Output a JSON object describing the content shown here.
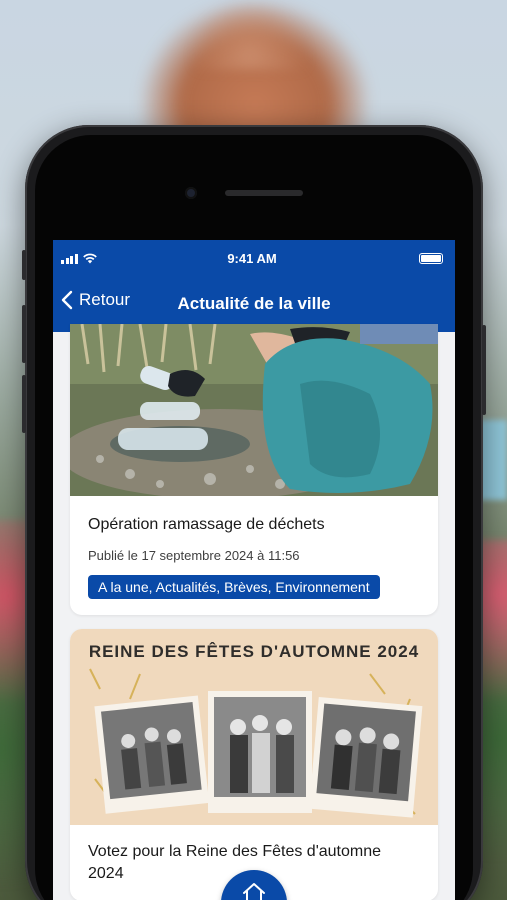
{
  "status_bar": {
    "time": "9:41 AM"
  },
  "nav": {
    "back_label": "Retour",
    "title": "Actualité de la ville"
  },
  "articles": [
    {
      "title": "Opération ramassage de déchets",
      "date": "Publié le 17 septembre 2024 à 11:56",
      "tags": "A la une, Actualités, Brèves, Environnement"
    },
    {
      "image_caption": "REINE DES FÊTES D'AUTOMNE 2024",
      "title": "Votez pour la Reine des Fêtes d'automne 2024"
    }
  ],
  "colors": {
    "brand": "#0a4aa8",
    "tag_bg": "#0a4aa8",
    "screen_bg": "#f1f2f4"
  },
  "icons": [
    "signal-icon",
    "wifi-icon",
    "battery-icon",
    "back-chevron-icon",
    "home-icon"
  ]
}
